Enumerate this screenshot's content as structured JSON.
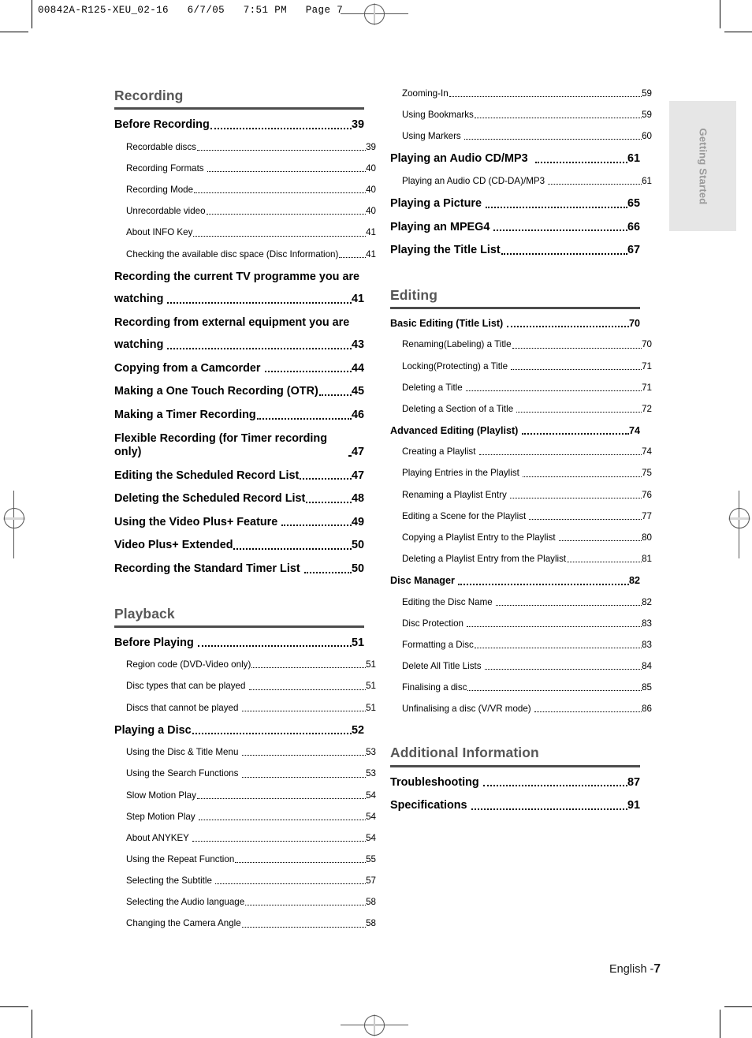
{
  "print_slug": "00842A-R125-XEU_02-16   6/7/05   7:51 PM   Page 7",
  "thumb_tab": {
    "label": "Getting Started"
  },
  "footer": {
    "language": "English -",
    "page_number": "7"
  },
  "colors": {
    "section_heading": "#575757",
    "section_rule": "#4d4d4d",
    "thumb_tab_bg": "#e6e6e6",
    "thumb_tab_text": "#9a9a9a",
    "body_text": "#000000"
  },
  "columns": {
    "left": [
      {
        "type": "section",
        "title": "Recording",
        "entries": [
          {
            "level": 1,
            "text": "Before Recording",
            "page": "39"
          },
          {
            "level": 2,
            "text": "Recordable discs",
            "page": "39"
          },
          {
            "level": 2,
            "text": "Recording Formats ",
            "page": "40"
          },
          {
            "level": 2,
            "text": "Recording Mode",
            "page": "40"
          },
          {
            "level": 2,
            "text": "Unrecordable video",
            "page": "40"
          },
          {
            "level": 2,
            "text": "About INFO Key",
            "page": "41"
          },
          {
            "level": 2,
            "text": "Checking the available disc space (Disc Information)",
            "page": "41"
          },
          {
            "level": 1,
            "text": "Recording the current TV programme you are",
            "page": "",
            "wrapped": true
          },
          {
            "level": 1,
            "text": "watching ",
            "page": "41"
          },
          {
            "level": 1,
            "text": "Recording from external equipment you are",
            "page": "",
            "wrapped": true
          },
          {
            "level": 1,
            "text": "watching ",
            "page": "43"
          },
          {
            "level": 1,
            "text": "Copying from a Camcorder ",
            "page": "44"
          },
          {
            "level": 1,
            "text": "Making a One Touch Recording (OTR)",
            "page": "45"
          },
          {
            "level": 1,
            "text": "Making a Timer Recording",
            "page": "46"
          },
          {
            "level": 1,
            "text": "Flexible Recording (for Timer recording only) ",
            "page": "47"
          },
          {
            "level": 1,
            "text": "Editing the Scheduled Record List",
            "page": "47"
          },
          {
            "level": 1,
            "text": "Deleting the Scheduled Record List",
            "page": "48"
          },
          {
            "level": 1,
            "text": "Using the Video Plus+ Feature ",
            "page": "49"
          },
          {
            "level": 1,
            "text": "Video Plus+ Extended",
            "page": "50"
          },
          {
            "level": 1,
            "text": "Recording the Standard Timer List ",
            "page": "50"
          }
        ]
      },
      {
        "type": "section",
        "title": "Playback",
        "entries": [
          {
            "level": 1,
            "text": "Before Playing ",
            "page": "51"
          },
          {
            "level": 2,
            "text": "Region code (DVD-Video only)",
            "page": "51"
          },
          {
            "level": 2,
            "text": "Disc types that can be played ",
            "page": "51"
          },
          {
            "level": 2,
            "text": "Discs that cannot be played ",
            "page": "51"
          },
          {
            "level": 1,
            "text": "Playing a Disc",
            "page": "52"
          },
          {
            "level": 2,
            "text": "Using the Disc & Title Menu ",
            "page": "53"
          },
          {
            "level": 2,
            "text": "Using the Search Functions ",
            "page": "53"
          },
          {
            "level": 2,
            "text": "Slow Motion Play",
            "page": "54"
          },
          {
            "level": 2,
            "text": "Step Motion Play ",
            "page": "54"
          },
          {
            "level": 2,
            "text": "About ANYKEY ",
            "page": "54"
          },
          {
            "level": 2,
            "text": "Using the Repeat Function",
            "page": "55"
          },
          {
            "level": 2,
            "text": "Selecting the Subtitle ",
            "page": "57"
          },
          {
            "level": 2,
            "text": "Selecting the Audio language",
            "page": "58"
          },
          {
            "level": 2,
            "text": "Changing the Camera Angle",
            "page": "58"
          }
        ]
      }
    ],
    "right": [
      {
        "type": "continuation",
        "title": "",
        "entries": [
          {
            "level": 2,
            "text": "Zooming-In",
            "page": "59"
          },
          {
            "level": 2,
            "text": "Using Bookmarks",
            "page": "59"
          },
          {
            "level": 2,
            "text": "Using Markers ",
            "page": "60"
          },
          {
            "level": 1,
            "text": "Playing an Audio CD/MP3  ",
            "page": "61"
          },
          {
            "level": 2,
            "text": "Playing an Audio CD (CD-DA)/MP3 ",
            "page": "61"
          },
          {
            "level": 1,
            "text": "Playing a Picture ",
            "page": "65"
          },
          {
            "level": 1,
            "text": "Playing an MPEG4 ",
            "page": "66"
          },
          {
            "level": 1,
            "text": "Playing the Title List",
            "page": "67"
          }
        ]
      },
      {
        "type": "section",
        "title": "Editing",
        "entries": [
          {
            "level": "1s",
            "text": "Basic Editing (Title List) ",
            "page": "70"
          },
          {
            "level": 2,
            "text": "Renaming(Labeling) a Title",
            "page": "70"
          },
          {
            "level": 2,
            "text": "Locking(Protecting) a Title ",
            "page": "71"
          },
          {
            "level": 2,
            "text": "Deleting a Title ",
            "page": "71"
          },
          {
            "level": 2,
            "text": "Deleting a Section of a Title ",
            "page": "72"
          },
          {
            "level": "1s",
            "text": "Advanced Editing (Playlist) ",
            "page": "74"
          },
          {
            "level": 2,
            "text": "Creating a Playlist ",
            "page": "74"
          },
          {
            "level": 2,
            "text": "Playing Entries in the Playlist ",
            "page": "75"
          },
          {
            "level": 2,
            "text": "Renaming a Playlist Entry ",
            "page": "76"
          },
          {
            "level": 2,
            "text": "Editing a Scene for the Playlist ",
            "page": "77"
          },
          {
            "level": 2,
            "text": "Copying a Playlist Entry to the Playlist ",
            "page": "80"
          },
          {
            "level": 2,
            "text": "Deleting a Playlist Entry from the Playlist",
            "page": "81"
          },
          {
            "level": "1s",
            "text": "Disc Manager ",
            "page": "82"
          },
          {
            "level": 2,
            "text": "Editing the Disc Name ",
            "page": "82"
          },
          {
            "level": 2,
            "text": "Disc Protection ",
            "page": "83"
          },
          {
            "level": 2,
            "text": "Formatting a Disc",
            "page": "83"
          },
          {
            "level": 2,
            "text": "Delete All Title Lists ",
            "page": "84"
          },
          {
            "level": 2,
            "text": "Finalising a disc",
            "page": "85"
          },
          {
            "level": 2,
            "text": "Unfinalising a disc (V/VR mode) ",
            "page": "86"
          }
        ]
      },
      {
        "type": "section",
        "title": "Additional Information",
        "entries": [
          {
            "level": 1,
            "text": "Troubleshooting ",
            "page": "87"
          },
          {
            "level": 1,
            "text": "Specifications ",
            "page": "91"
          }
        ]
      }
    ]
  }
}
